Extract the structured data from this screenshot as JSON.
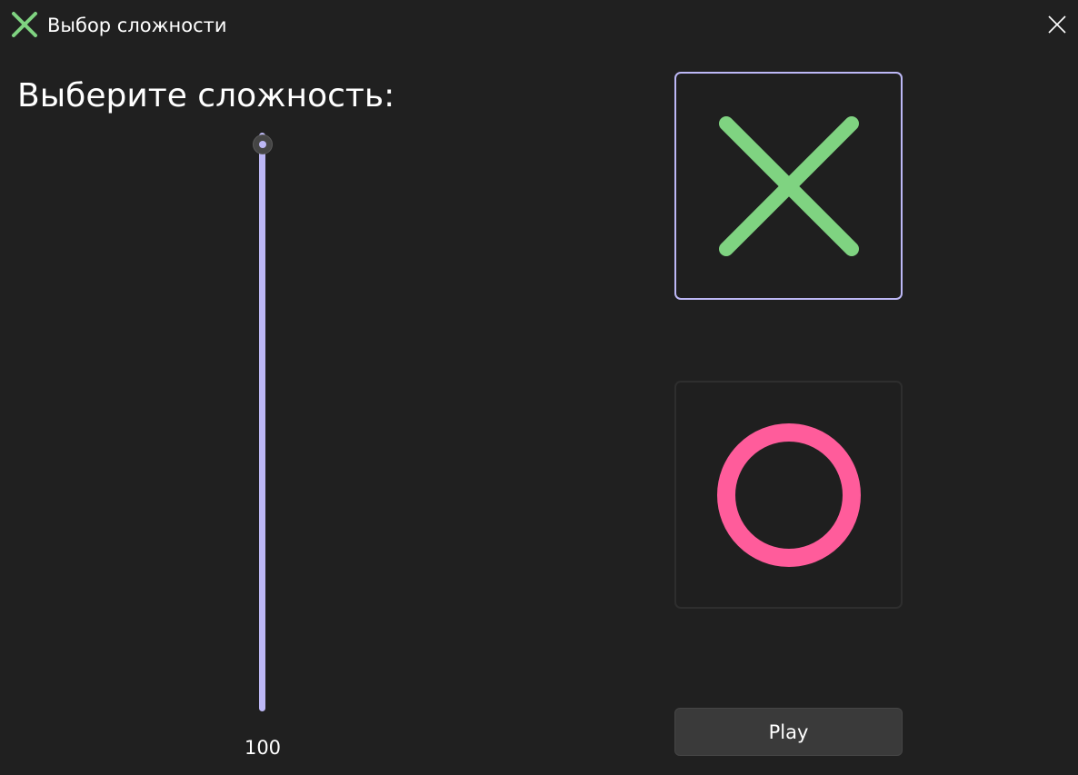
{
  "window": {
    "title": "Выбор сложности",
    "app_icon": "x-mark-icon",
    "close_icon": "close-icon"
  },
  "main": {
    "heading": "Выберите сложность:",
    "difficulty_slider": {
      "orientation": "vertical",
      "value": 100,
      "value_label": "100",
      "fill_fraction": 1.0,
      "track_color": "#bdb8f6"
    },
    "player_choices": [
      {
        "symbol": "X",
        "icon": "x-mark-icon",
        "color": "#7fd381",
        "selected": true
      },
      {
        "symbol": "O",
        "icon": "circle-icon",
        "color": "#ff5c9b",
        "selected": false
      }
    ],
    "play_button_label": "Play"
  },
  "colors": {
    "background": "#202020",
    "accent": "#bdb8f6",
    "x_green": "#7fd381",
    "o_pink": "#ff5c9b"
  }
}
